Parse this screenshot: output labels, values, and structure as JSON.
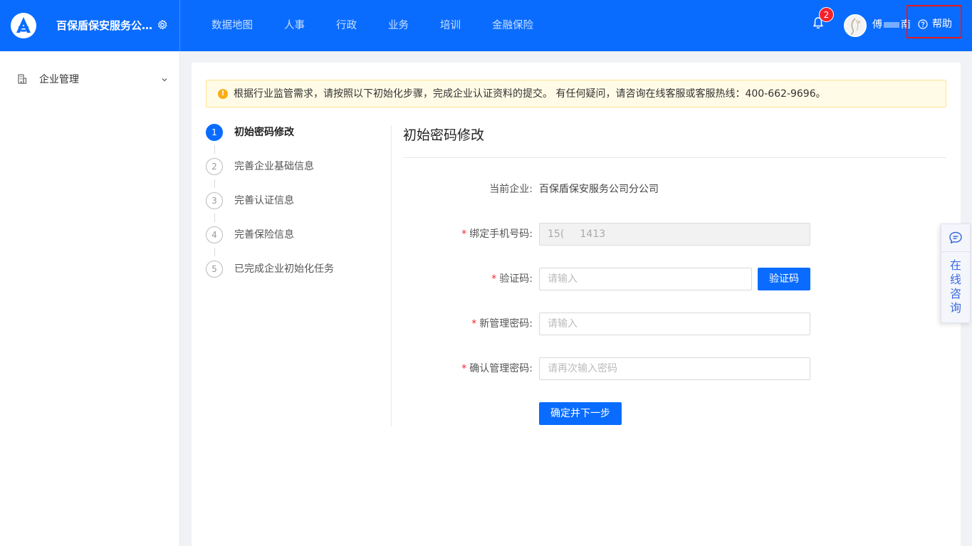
{
  "header": {
    "company_name": "百保盾保安服务公司...",
    "nav": [
      "数据地图",
      "人事",
      "行政",
      "业务",
      "培训",
      "金融保险"
    ],
    "notification_count": "2",
    "user_name_first": "傅",
    "user_name_last": "南",
    "help_label": "帮助"
  },
  "sidebar": {
    "items": [
      {
        "label": "企业管理"
      }
    ]
  },
  "alert": {
    "text": "根据行业监管需求，请按照以下初始化步骤，完成企业认证资料的提交。 有任何疑问，请咨询在线客服或客服热线：400-662-9696。"
  },
  "steps": [
    {
      "num": "1",
      "label": "初始密码修改",
      "active": true
    },
    {
      "num": "2",
      "label": "完善企业基础信息",
      "active": false
    },
    {
      "num": "3",
      "label": "完善认证信息",
      "active": false
    },
    {
      "num": "4",
      "label": "完善保险信息",
      "active": false
    },
    {
      "num": "5",
      "label": "已完成企业初始化任务",
      "active": false
    }
  ],
  "form": {
    "title": "初始密码修改",
    "company_label": "当前企业:",
    "company_value": "百保盾保安服务公司分公司",
    "phone_label": "绑定手机号码:",
    "phone_value": "15(     1413",
    "code_label": "验证码:",
    "code_placeholder": "请输入",
    "code_button": "验证码",
    "new_pwd_label": "新管理密码:",
    "new_pwd_placeholder": "请输入",
    "confirm_pwd_label": "确认管理密码:",
    "confirm_pwd_placeholder": "请再次输入密码",
    "submit_button": "确定并下一步"
  },
  "float_chat": {
    "label": "在线咨询"
  },
  "colors": {
    "primary": "#0a6cff",
    "badge": "#f5222d",
    "alert_bg": "#fffbe6",
    "alert_icon": "#faad14",
    "required": "#f5222d"
  },
  "icons": [
    "logo-icon",
    "gear-icon",
    "bell-icon",
    "help-circle-icon",
    "building-icon",
    "chevron-down-icon",
    "warning-icon",
    "chat-bubble-icon"
  ]
}
